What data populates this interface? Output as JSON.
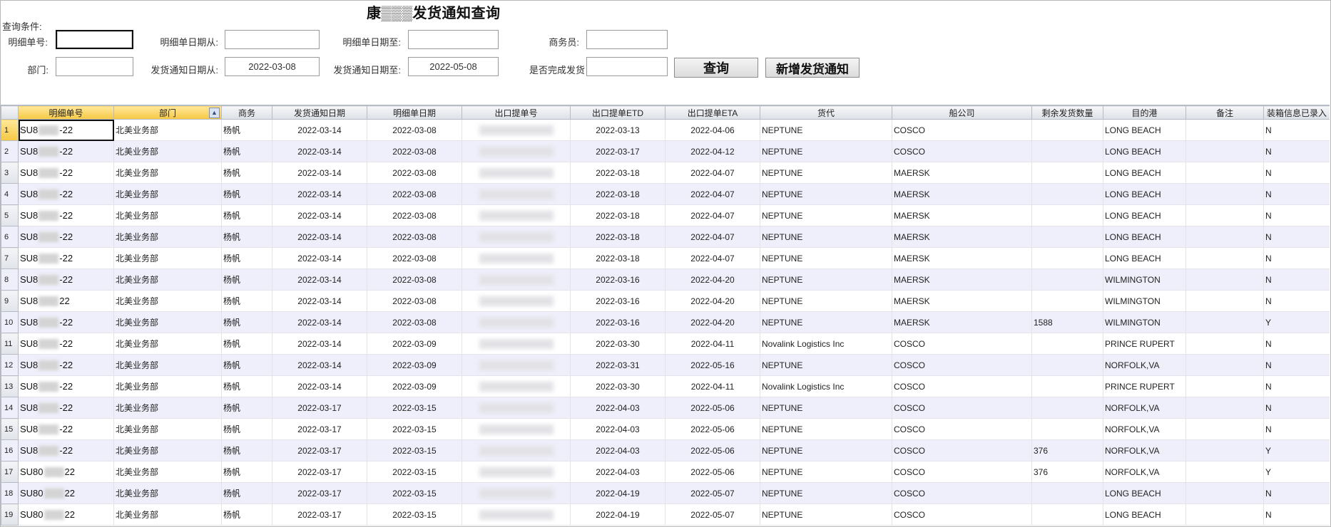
{
  "page": {
    "title": "康▒▒▒发货通知查询",
    "conditions_label": "查询条件:"
  },
  "form": {
    "detail_no_label": "明细单号:",
    "detail_no_value": "",
    "detail_date_from_label": "明细单日期从:",
    "detail_date_from_value": "",
    "detail_date_to_label": "明细单日期至:",
    "detail_date_to_value": "",
    "salesperson_label": "商务员:",
    "salesperson_value": "",
    "dept_label": "部门:",
    "dept_value": "",
    "notice_date_from_label": "发货通知日期从:",
    "notice_date_from_value": "2022-03-08",
    "notice_date_to_label": "发货通知日期至:",
    "notice_date_to_value": "2022-05-08",
    "completed_label": "是否完成发货",
    "completed_value": "",
    "query_button": "查询",
    "add_button": "新增发货通知"
  },
  "table": {
    "columns": [
      "明细单号",
      "部门",
      "商务",
      "发货通知日期",
      "明细单日期",
      "出口提单号",
      "出口提单ETD",
      "出口提单ETA",
      "货代",
      "船公司",
      "剩余发货数量",
      "目的港",
      "备注",
      "装箱信息已录入"
    ],
    "rows": [
      {
        "n": "1",
        "id_a": "SU8",
        "id_b": "-22",
        "dept": "北美业务部",
        "sales": "杨帆",
        "notice": "2022-03-14",
        "detail": "2022-03-08",
        "etd": "2022-03-13",
        "eta": "2022-04-06",
        "fwd": "NEPTUNE",
        "line": "COSCO",
        "qty": "",
        "port": "LONG BEACH",
        "note": "",
        "packed": "N"
      },
      {
        "n": "2",
        "id_a": "SU8",
        "id_b": "-22",
        "dept": "北美业务部",
        "sales": "杨帆",
        "notice": "2022-03-14",
        "detail": "2022-03-08",
        "etd": "2022-03-17",
        "eta": "2022-04-12",
        "fwd": "NEPTUNE",
        "line": "COSCO",
        "qty": "",
        "port": "LONG BEACH",
        "note": "",
        "packed": "N"
      },
      {
        "n": "3",
        "id_a": "SU8",
        "id_b": "-22",
        "dept": "北美业务部",
        "sales": "杨帆",
        "notice": "2022-03-14",
        "detail": "2022-03-08",
        "etd": "2022-03-18",
        "eta": "2022-04-07",
        "fwd": "NEPTUNE",
        "line": "MAERSK",
        "qty": "",
        "port": "LONG BEACH",
        "note": "",
        "packed": "N"
      },
      {
        "n": "4",
        "id_a": "SU8",
        "id_b": "-22",
        "dept": "北美业务部",
        "sales": "杨帆",
        "notice": "2022-03-14",
        "detail": "2022-03-08",
        "etd": "2022-03-18",
        "eta": "2022-04-07",
        "fwd": "NEPTUNE",
        "line": "MAERSK",
        "qty": "",
        "port": "LONG BEACH",
        "note": "",
        "packed": "N"
      },
      {
        "n": "5",
        "id_a": "SU8",
        "id_b": "-22",
        "dept": "北美业务部",
        "sales": "杨帆",
        "notice": "2022-03-14",
        "detail": "2022-03-08",
        "etd": "2022-03-18",
        "eta": "2022-04-07",
        "fwd": "NEPTUNE",
        "line": "MAERSK",
        "qty": "",
        "port": "LONG BEACH",
        "note": "",
        "packed": "N"
      },
      {
        "n": "6",
        "id_a": "SU8",
        "id_b": "-22",
        "dept": "北美业务部",
        "sales": "杨帆",
        "notice": "2022-03-14",
        "detail": "2022-03-08",
        "etd": "2022-03-18",
        "eta": "2022-04-07",
        "fwd": "NEPTUNE",
        "line": "MAERSK",
        "qty": "",
        "port": "LONG BEACH",
        "note": "",
        "packed": "N"
      },
      {
        "n": "7",
        "id_a": "SU8",
        "id_b": "-22",
        "dept": "北美业务部",
        "sales": "杨帆",
        "notice": "2022-03-14",
        "detail": "2022-03-08",
        "etd": "2022-03-18",
        "eta": "2022-04-07",
        "fwd": "NEPTUNE",
        "line": "MAERSK",
        "qty": "",
        "port": "LONG BEACH",
        "note": "",
        "packed": "N"
      },
      {
        "n": "8",
        "id_a": "SU8",
        "id_b": "-22",
        "dept": "北美业务部",
        "sales": "杨帆",
        "notice": "2022-03-14",
        "detail": "2022-03-08",
        "etd": "2022-03-16",
        "eta": "2022-04-20",
        "fwd": "NEPTUNE",
        "line": "MAERSK",
        "qty": "",
        "port": "WILMINGTON",
        "note": "",
        "packed": "N"
      },
      {
        "n": "9",
        "id_a": "SU8",
        "id_b": "22",
        "dept": "北美业务部",
        "sales": "杨帆",
        "notice": "2022-03-14",
        "detail": "2022-03-08",
        "etd": "2022-03-16",
        "eta": "2022-04-20",
        "fwd": "NEPTUNE",
        "line": "MAERSK",
        "qty": "",
        "port": "WILMINGTON",
        "note": "",
        "packed": "N"
      },
      {
        "n": "10",
        "id_a": "SU8",
        "id_b": "-22",
        "dept": "北美业务部",
        "sales": "杨帆",
        "notice": "2022-03-14",
        "detail": "2022-03-08",
        "etd": "2022-03-16",
        "eta": "2022-04-20",
        "fwd": "NEPTUNE",
        "line": "MAERSK",
        "qty": "1588",
        "port": "WILMINGTON",
        "note": "",
        "packed": "Y"
      },
      {
        "n": "11",
        "id_a": "SU8",
        "id_b": "-22",
        "dept": "北美业务部",
        "sales": "杨帆",
        "notice": "2022-03-14",
        "detail": "2022-03-09",
        "etd": "2022-03-30",
        "eta": "2022-04-11",
        "fwd": "Novalink Logistics Inc",
        "line": "COSCO",
        "qty": "",
        "port": "PRINCE RUPERT",
        "note": "",
        "packed": "N"
      },
      {
        "n": "12",
        "id_a": "SU8",
        "id_b": "-22",
        "dept": "北美业务部",
        "sales": "杨帆",
        "notice": "2022-03-14",
        "detail": "2022-03-09",
        "etd": "2022-03-31",
        "eta": "2022-05-16",
        "fwd": "NEPTUNE",
        "line": "COSCO",
        "qty": "",
        "port": "NORFOLK,VA",
        "note": "",
        "packed": "N"
      },
      {
        "n": "13",
        "id_a": "SU8",
        "id_b": "-22",
        "dept": "北美业务部",
        "sales": "杨帆",
        "notice": "2022-03-14",
        "detail": "2022-03-09",
        "etd": "2022-03-30",
        "eta": "2022-04-11",
        "fwd": "Novalink Logistics Inc",
        "line": "COSCO",
        "qty": "",
        "port": "PRINCE RUPERT",
        "note": "",
        "packed": "N"
      },
      {
        "n": "14",
        "id_a": "SU8",
        "id_b": "-22",
        "dept": "北美业务部",
        "sales": "杨帆",
        "notice": "2022-03-17",
        "detail": "2022-03-15",
        "etd": "2022-04-03",
        "eta": "2022-05-06",
        "fwd": "NEPTUNE",
        "line": "COSCO",
        "qty": "",
        "port": "NORFOLK,VA",
        "note": "",
        "packed": "N"
      },
      {
        "n": "15",
        "id_a": "SU8",
        "id_b": "-22",
        "dept": "北美业务部",
        "sales": "杨帆",
        "notice": "2022-03-17",
        "detail": "2022-03-15",
        "etd": "2022-04-03",
        "eta": "2022-05-06",
        "fwd": "NEPTUNE",
        "line": "COSCO",
        "qty": "",
        "port": "NORFOLK,VA",
        "note": "",
        "packed": "N"
      },
      {
        "n": "16",
        "id_a": "SU8",
        "id_b": "-22",
        "dept": "北美业务部",
        "sales": "杨帆",
        "notice": "2022-03-17",
        "detail": "2022-03-15",
        "etd": "2022-04-03",
        "eta": "2022-05-06",
        "fwd": "NEPTUNE",
        "line": "COSCO",
        "qty": "376",
        "port": "NORFOLK,VA",
        "note": "",
        "packed": "Y"
      },
      {
        "n": "17",
        "id_a": "SU80",
        "id_b": "22",
        "dept": "北美业务部",
        "sales": "杨帆",
        "notice": "2022-03-17",
        "detail": "2022-03-15",
        "etd": "2022-04-03",
        "eta": "2022-05-06",
        "fwd": "NEPTUNE",
        "line": "COSCO",
        "qty": "376",
        "port": "NORFOLK,VA",
        "note": "",
        "packed": "Y"
      },
      {
        "n": "18",
        "id_a": "SU80",
        "id_b": "22",
        "dept": "北美业务部",
        "sales": "杨帆",
        "notice": "2022-03-17",
        "detail": "2022-03-15",
        "etd": "2022-04-19",
        "eta": "2022-05-07",
        "fwd": "NEPTUNE",
        "line": "COSCO",
        "qty": "",
        "port": "LONG BEACH",
        "note": "",
        "packed": "N"
      },
      {
        "n": "19",
        "id_a": "SU80",
        "id_b": "22",
        "dept": "北美业务部",
        "sales": "杨帆",
        "notice": "2022-03-17",
        "detail": "2022-03-15",
        "etd": "2022-04-19",
        "eta": "2022-05-07",
        "fwd": "NEPTUNE",
        "line": "COSCO",
        "qty": "",
        "port": "LONG BEACH",
        "note": "",
        "packed": "N"
      }
    ]
  }
}
